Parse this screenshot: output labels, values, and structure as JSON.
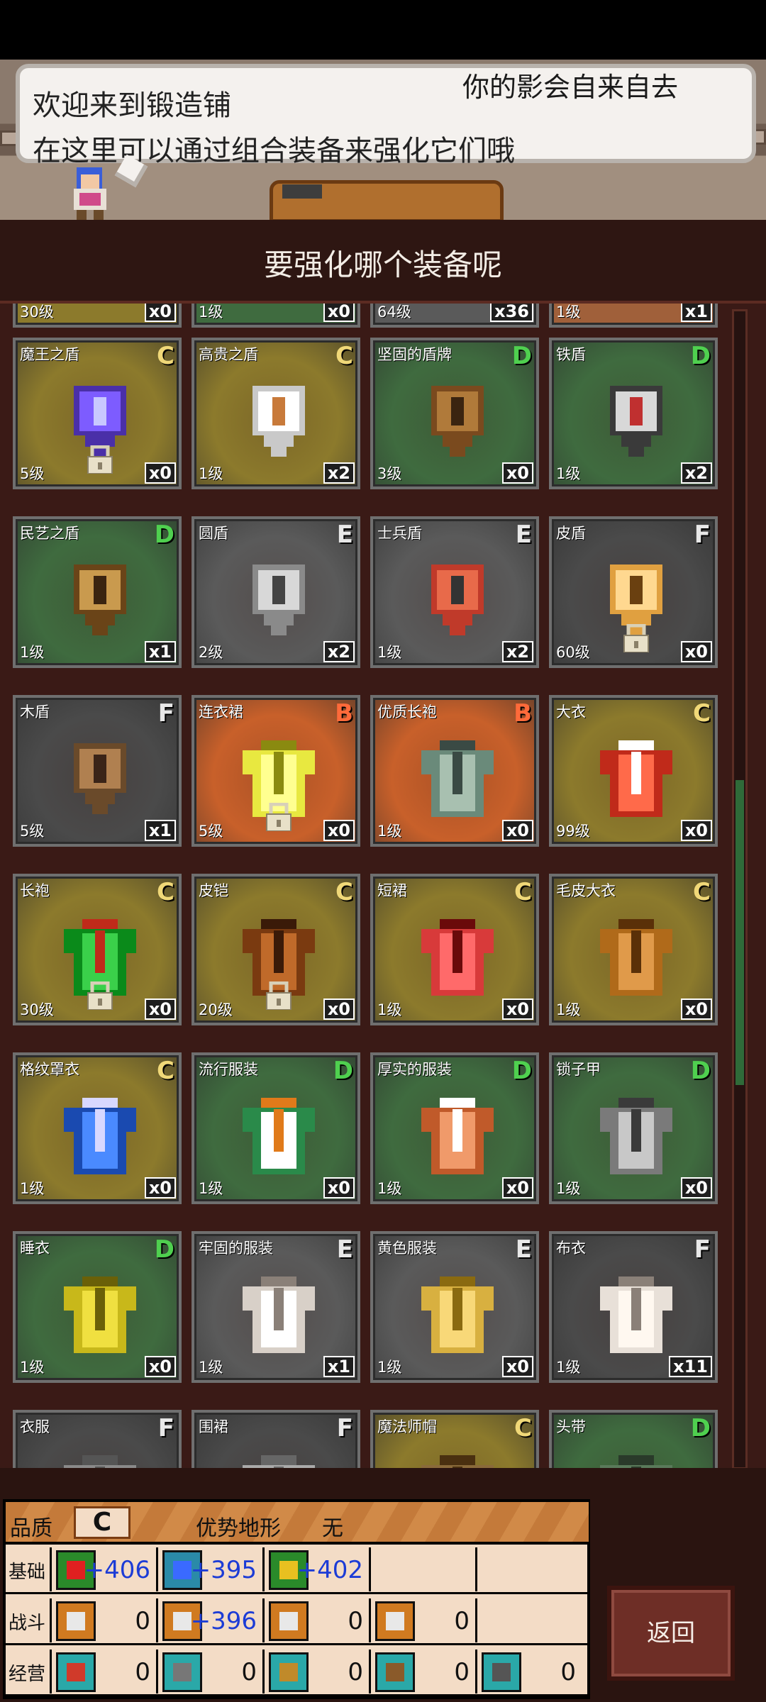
{
  "dialog": {
    "line1": "欢迎来到锻造铺",
    "line2": "在这里可以通过组合装备来强化它们哦",
    "header_fade": "你的影会自来自去"
  },
  "header": {
    "title": "要强化哪个装备呢"
  },
  "grid": {
    "partial_top": [
      {
        "level": "30级",
        "count": "x0"
      },
      {
        "level": "1级",
        "count": "x0"
      },
      {
        "level": "64级",
        "count": "x36"
      },
      {
        "level": "1级",
        "count": "x1"
      }
    ],
    "cards": [
      {
        "name": "魔王之盾",
        "grade": "C",
        "level": "5级",
        "count": "x0",
        "locked": true
      },
      {
        "name": "高贵之盾",
        "grade": "C",
        "level": "1级",
        "count": "x2",
        "locked": false
      },
      {
        "name": "坚固的盾牌",
        "grade": "D",
        "level": "3级",
        "count": "x0",
        "locked": false
      },
      {
        "name": "铁盾",
        "grade": "D",
        "level": "1级",
        "count": "x2",
        "locked": false
      },
      {
        "name": "民艺之盾",
        "grade": "D",
        "level": "1级",
        "count": "x1",
        "locked": false
      },
      {
        "name": "圆盾",
        "grade": "E",
        "level": "2级",
        "count": "x2",
        "locked": false
      },
      {
        "name": "士兵盾",
        "grade": "E",
        "level": "1级",
        "count": "x2",
        "locked": false
      },
      {
        "name": "皮盾",
        "grade": "F",
        "level": "60级",
        "count": "x0",
        "locked": true
      },
      {
        "name": "木盾",
        "grade": "F",
        "level": "5级",
        "count": "x1",
        "locked": false
      },
      {
        "name": "连衣裙",
        "grade": "B",
        "level": "5级",
        "count": "x0",
        "locked": true
      },
      {
        "name": "优质长袍",
        "grade": "B",
        "level": "1级",
        "count": "x0",
        "locked": false
      },
      {
        "name": "大衣",
        "grade": "C",
        "level": "99级",
        "count": "x0",
        "locked": false
      },
      {
        "name": "长袍",
        "grade": "C",
        "level": "30级",
        "count": "x0",
        "locked": true
      },
      {
        "name": "皮铠",
        "grade": "C",
        "level": "20级",
        "count": "x0",
        "locked": true
      },
      {
        "name": "短裙",
        "grade": "C",
        "level": "1级",
        "count": "x0",
        "locked": false
      },
      {
        "name": "毛皮大衣",
        "grade": "C",
        "level": "1级",
        "count": "x0",
        "locked": false
      },
      {
        "name": "格纹罩衣",
        "grade": "C",
        "level": "1级",
        "count": "x0",
        "locked": false
      },
      {
        "name": "流行服装",
        "grade": "D",
        "level": "1级",
        "count": "x0",
        "locked": false
      },
      {
        "name": "厚实的服装",
        "grade": "D",
        "level": "1级",
        "count": "x0",
        "locked": false
      },
      {
        "name": "锁子甲",
        "grade": "D",
        "level": "1级",
        "count": "x0",
        "locked": false
      },
      {
        "name": "睡衣",
        "grade": "D",
        "level": "1级",
        "count": "x0",
        "locked": false
      },
      {
        "name": "牢固的服装",
        "grade": "E",
        "level": "1级",
        "count": "x1",
        "locked": false
      },
      {
        "name": "黄色服装",
        "grade": "E",
        "level": "1级",
        "count": "x0",
        "locked": false
      },
      {
        "name": "布衣",
        "grade": "F",
        "level": "1级",
        "count": "x11",
        "locked": false
      },
      {
        "name": "衣服",
        "grade": "F",
        "level": "",
        "count": "",
        "locked": false
      },
      {
        "name": "围裙",
        "grade": "F",
        "level": "",
        "count": "",
        "locked": false
      },
      {
        "name": "魔法师帽",
        "grade": "C",
        "level": "",
        "count": "",
        "locked": false
      },
      {
        "name": "头带",
        "grade": "D",
        "level": "",
        "count": "",
        "locked": false
      }
    ]
  },
  "stats": {
    "quality_label": "品质",
    "quality_value": "C",
    "terrain_label": "优势地形",
    "terrain_value": "无",
    "rows": [
      {
        "label": "基础",
        "cells": [
          {
            "icon": "heart-icon",
            "value": "+406"
          },
          {
            "icon": "potion-icon",
            "value": "+395"
          },
          {
            "icon": "boot-icon",
            "value": "+402"
          },
          {
            "icon": "",
            "value": ""
          },
          {
            "icon": "",
            "value": ""
          }
        ]
      },
      {
        "label": "战斗",
        "cells": [
          {
            "icon": "sword-icon",
            "value": "0"
          },
          {
            "icon": "shield-icon",
            "value": "+396"
          },
          {
            "icon": "swap-arrows-icon",
            "value": "0"
          },
          {
            "icon": "star-icon",
            "value": "0"
          },
          {
            "icon": "",
            "value": ""
          }
        ]
      },
      {
        "label": "经营",
        "cells": [
          {
            "icon": "book-icon",
            "value": "0"
          },
          {
            "icon": "hammer-icon",
            "value": "0"
          },
          {
            "icon": "shovel-icon",
            "value": "0"
          },
          {
            "icon": "chest-icon",
            "value": "0"
          },
          {
            "icon": "wrench-icon",
            "value": "0"
          }
        ]
      }
    ]
  },
  "back_label": "返回",
  "colors": {
    "grade_B": "#ff6a3a",
    "grade_C": "#f0d878",
    "grade_D": "#4fd04f",
    "grade_E": "#e8e8e8",
    "grade_F": "#e8e8e8",
    "bg_B": "#c8602a",
    "bg_C": "#8c7a2c",
    "bg_D": "#3f6b3f",
    "bg_E": "#5a5a5a",
    "bg_F": "#4a4a4a",
    "plus_value": "#1c3cd6"
  }
}
